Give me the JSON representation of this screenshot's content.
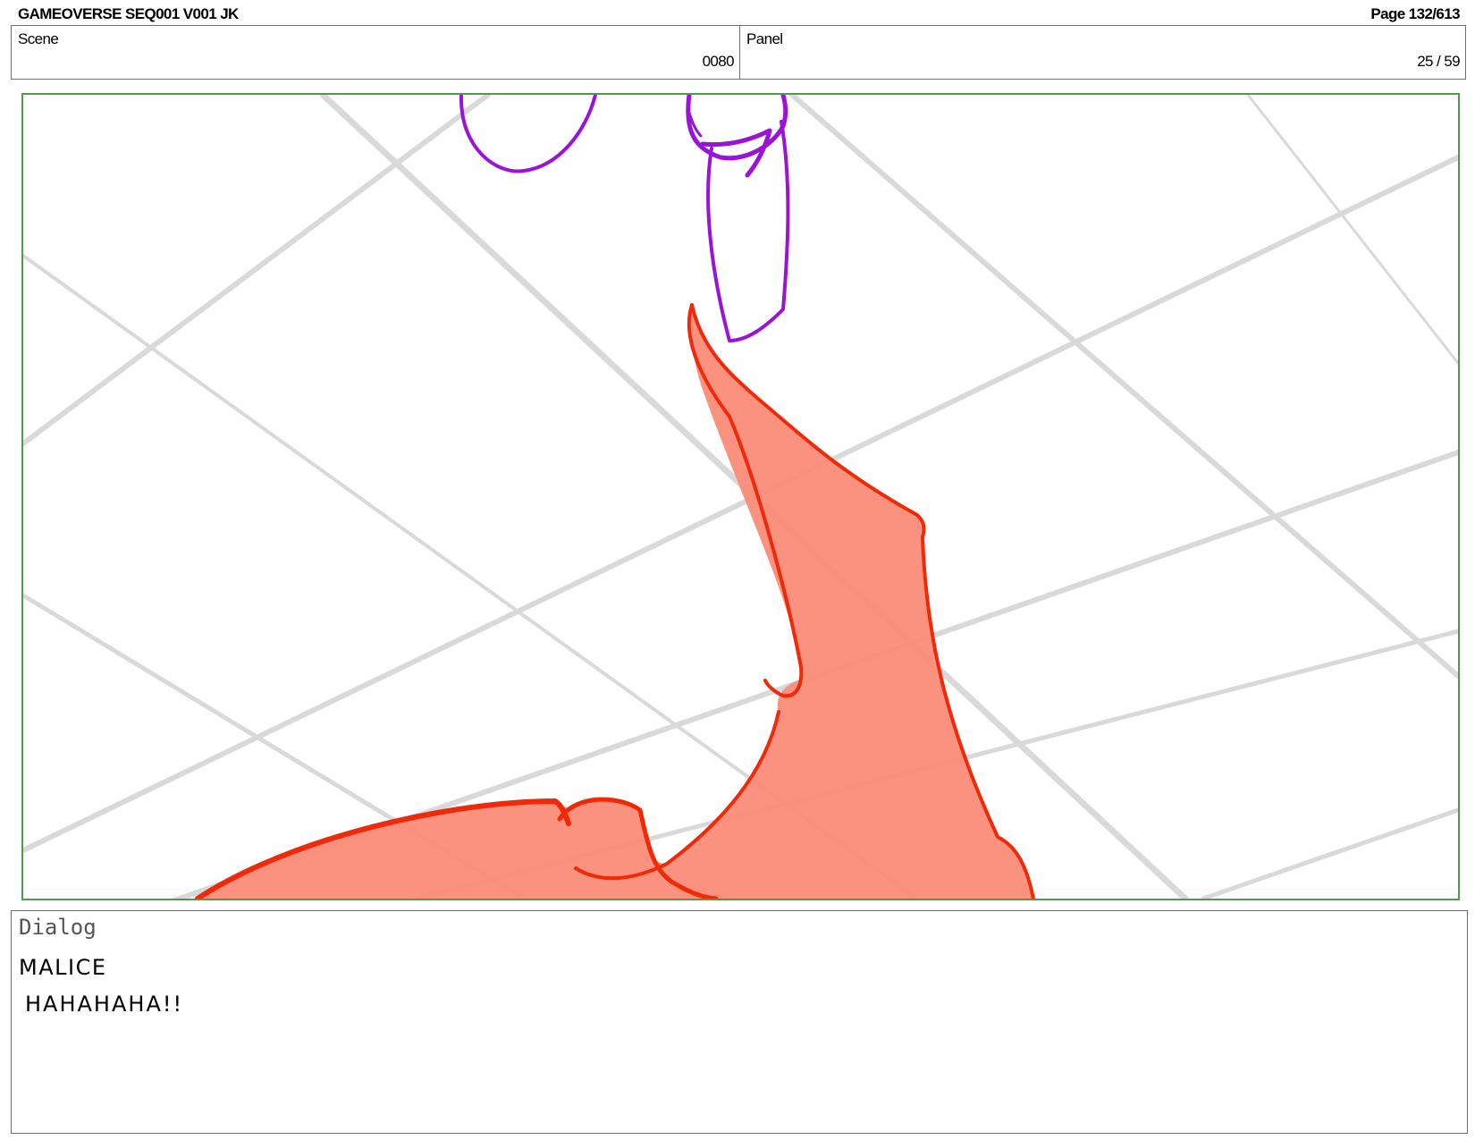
{
  "header": {
    "title": "GAMEOVERSE SEQ001 V001 JK",
    "page": "Page 132/613"
  },
  "info": {
    "scene_label": "Scene",
    "scene_value": "0080",
    "panel_label": "Panel",
    "panel_value": "25 / 59"
  },
  "colors": {
    "frame_border": "#4f9a4f",
    "grid_lines": "#d9d9d9",
    "purple_sketch": "#9a14d6",
    "red_outline": "#f02a08",
    "salmon_fill": "#fa8c78"
  },
  "dialog": {
    "label": "Dialog",
    "speaker": "MALICE",
    "line": "HAHAHAHA!!"
  }
}
